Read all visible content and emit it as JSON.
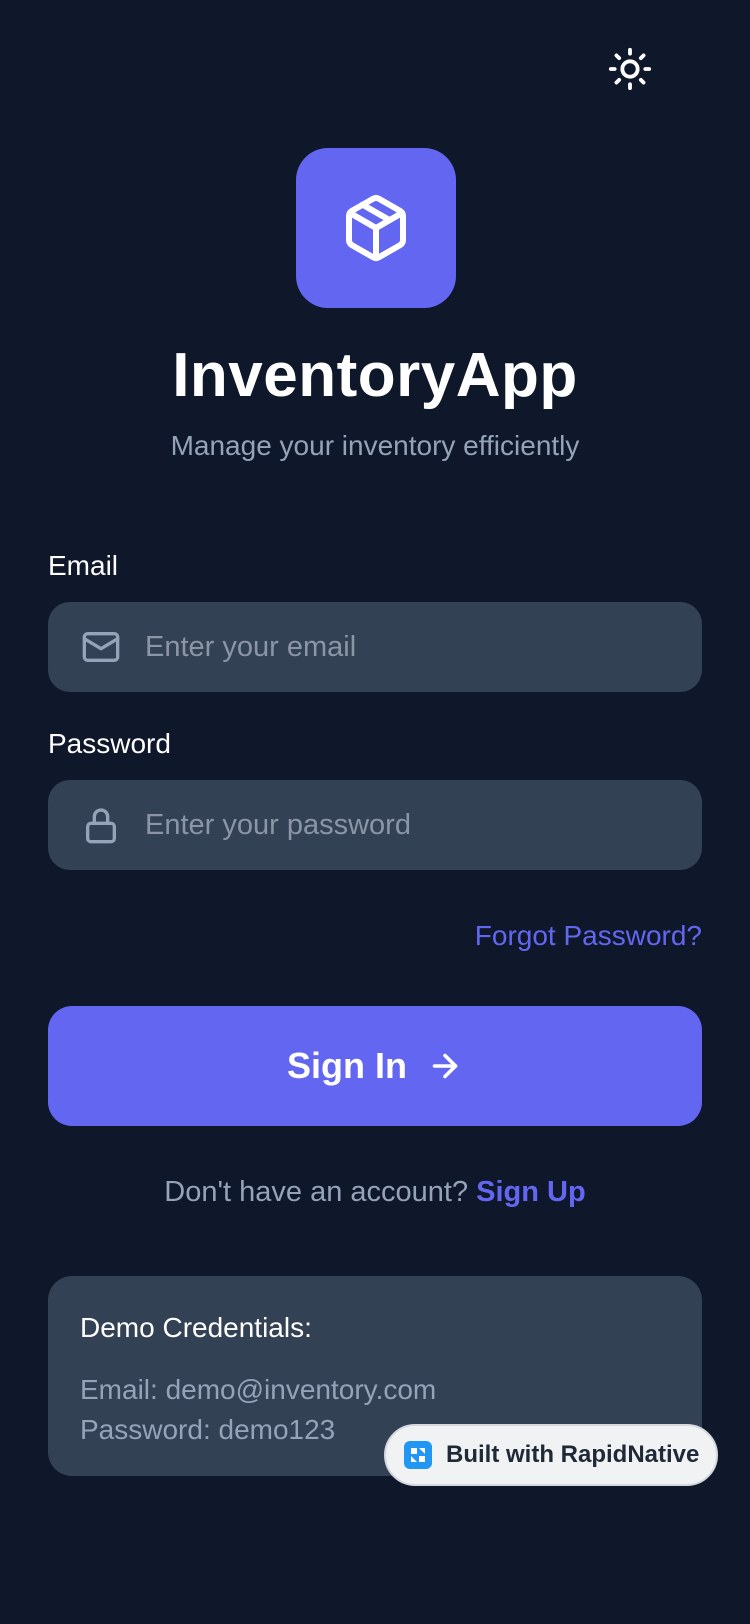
{
  "app": {
    "title": "InventoryApp",
    "subtitle": "Manage your inventory efficiently"
  },
  "icons": {
    "theme_toggle": "sun-icon",
    "logo": "package-icon",
    "email": "mail-icon",
    "password": "lock-icon",
    "signin": "arrow-right-icon"
  },
  "colors": {
    "background": "#0f172a",
    "accent": "#6366f1",
    "input_bg": "#334155",
    "muted_text": "#94a3b8"
  },
  "form": {
    "email": {
      "label": "Email",
      "value": "",
      "placeholder": "Enter your email"
    },
    "password": {
      "label": "Password",
      "value": "",
      "placeholder": "Enter your password"
    },
    "forgot_password": "Forgot Password?",
    "signin_label": "Sign In"
  },
  "signup": {
    "prompt": "Don't have an account? ",
    "link": "Sign Up"
  },
  "demo": {
    "title": "Demo Credentials:",
    "email_line": "Email: demo@inventory.com",
    "password_line": "Password: demo123"
  },
  "badge": {
    "label": "Built with RapidNative"
  }
}
